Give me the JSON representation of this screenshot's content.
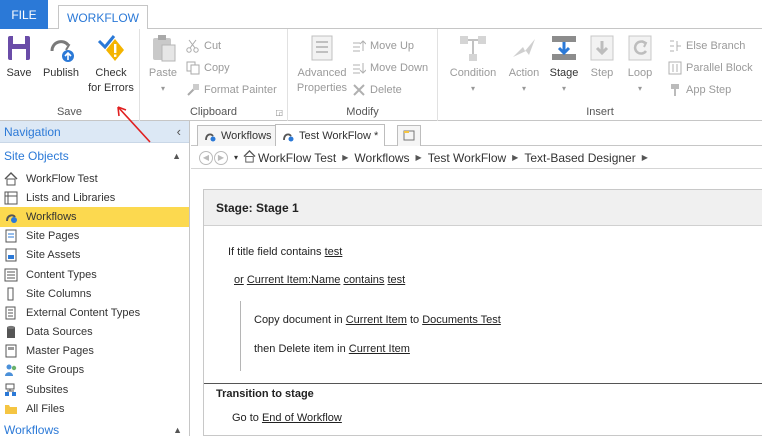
{
  "tabs": {
    "file": "FILE",
    "workflow": "WORKFLOW"
  },
  "ribbon": {
    "save": {
      "save": "Save",
      "publish": "Publish",
      "check": "Check",
      "check2": "for Errors",
      "label": "Save"
    },
    "clipboard": {
      "paste": "Paste",
      "cut": "Cut",
      "copy": "Copy",
      "format_painter": "Format Painter",
      "label": "Clipboard"
    },
    "modify": {
      "advanced": "Advanced",
      "properties": "Properties",
      "move_up": "Move Up",
      "move_down": "Move Down",
      "delete": "Delete",
      "label": "Modify"
    },
    "insert": {
      "condition": "Condition",
      "action": "Action",
      "stage": "Stage",
      "step": "Step",
      "loop": "Loop",
      "else_branch": "Else Branch",
      "parallel_block": "Parallel Block",
      "app_step": "App Step",
      "label": "Insert"
    }
  },
  "nav": {
    "header": "Navigation",
    "collapse": "‹",
    "section": "Site Objects",
    "items": [
      {
        "label": "WorkFlow Test",
        "icon": "home-icon"
      },
      {
        "label": "Lists and Libraries",
        "icon": "list-icon"
      },
      {
        "label": "Workflows",
        "icon": "workflow-icon"
      },
      {
        "label": "Site Pages",
        "icon": "pages-icon"
      },
      {
        "label": "Site Assets",
        "icon": "assets-icon"
      },
      {
        "label": "Content Types",
        "icon": "content-types-icon"
      },
      {
        "label": "Site Columns",
        "icon": "columns-icon"
      },
      {
        "label": "External Content Types",
        "icon": "external-icon"
      },
      {
        "label": "Data Sources",
        "icon": "database-icon"
      },
      {
        "label": "Master Pages",
        "icon": "master-icon"
      },
      {
        "label": "Site Groups",
        "icon": "groups-icon"
      },
      {
        "label": "Subsites",
        "icon": "subsites-icon"
      },
      {
        "label": "All Files",
        "icon": "folder-icon"
      }
    ],
    "bottom": "Workflows"
  },
  "doc_tabs": [
    {
      "label": "Workflows"
    },
    {
      "label": "Test WorkFlow *"
    }
  ],
  "breadcrumb": [
    "WorkFlow Test",
    "Workflows",
    "Test WorkFlow",
    "Text-Based Designer"
  ],
  "designer": {
    "stage_title": "Stage: Stage 1",
    "cond1": {
      "prefix": "If title field contains",
      "value": "test"
    },
    "cond2": {
      "or": "or",
      "field": "Current Item:Name",
      "op": "contains",
      "value": "test"
    },
    "action1": {
      "prefix": "Copy document in",
      "src": "Current Item",
      "mid": "to",
      "dest": "Documents Test"
    },
    "action2": {
      "prefix": "then Delete item in",
      "target": "Current Item"
    },
    "transition_title": "Transition to stage",
    "goto": {
      "prefix": "Go to",
      "target": "End of Workflow"
    }
  },
  "colors": {
    "accent": "#2b79d7",
    "selected": "#fcd94f",
    "warning": "#f4b400",
    "annotation": "#e02020"
  }
}
